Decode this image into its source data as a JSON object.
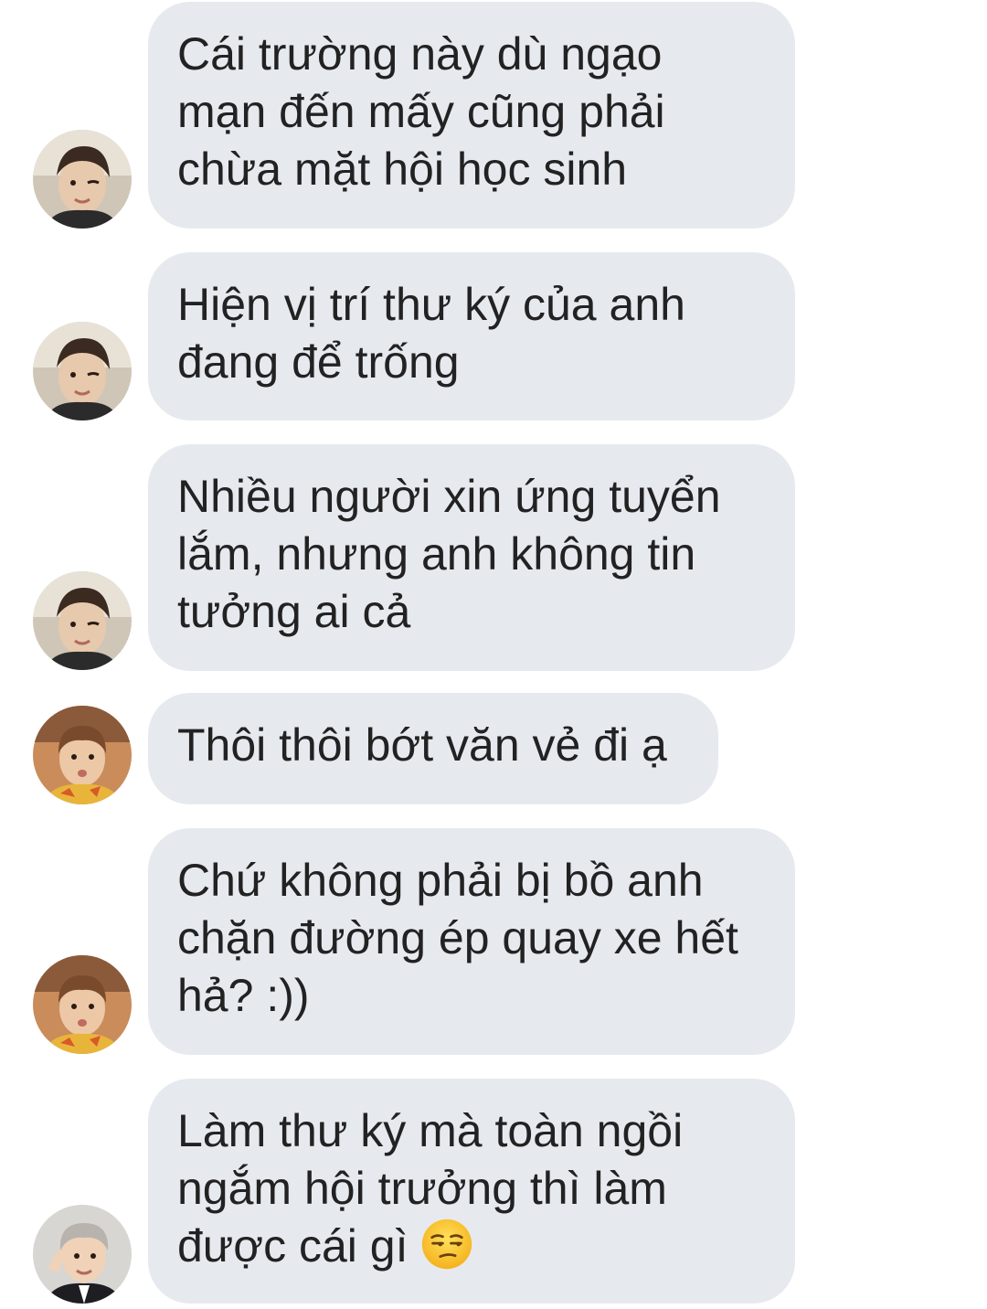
{
  "messages": [
    {
      "text": "Cái trường này dù ngạo\nmạn đến mấy cũng phải\nchừa mặt hội học sinh",
      "avatar": "avatar-person-a",
      "emoji": ""
    },
    {
      "text": "Hiện vị trí thư ký của anh\nđang để trống",
      "avatar": "avatar-person-a",
      "emoji": ""
    },
    {
      "text": "Nhiều người xin ứng tuyển\nlắm, nhưng anh không tin\ntưởng ai cả",
      "avatar": "avatar-person-a",
      "emoji": ""
    },
    {
      "text": "Thôi thôi bớt văn vẻ đi ạ",
      "avatar": "avatar-person-b",
      "emoji": ""
    },
    {
      "text": "Chứ không phải bị bồ anh\nchặn đường ép quay xe hết\nhả? :))",
      "avatar": "avatar-person-b",
      "emoji": ""
    },
    {
      "text": "Làm thư ký mà toàn ngồi\nngắm hội trưởng thì làm\nđược cái gì ",
      "avatar": "avatar-person-c",
      "emoji": "unamused-face-emoji"
    }
  ],
  "colors": {
    "bubble": "#e6eaef",
    "text": "#222222",
    "background": "#ffffff"
  }
}
